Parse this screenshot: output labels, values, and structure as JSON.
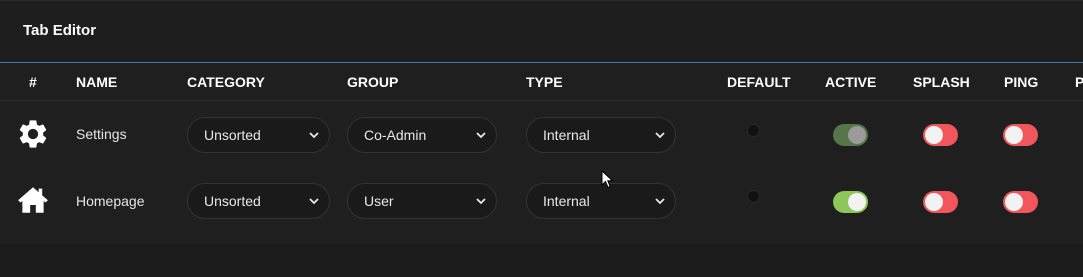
{
  "panel": {
    "title": "Tab Editor"
  },
  "columns": [
    "#",
    "NAME",
    "CATEGORY",
    "GROUP",
    "TYPE",
    "DEFAULT",
    "ACTIVE",
    "SPLASH",
    "PING",
    "P"
  ],
  "rows": [
    {
      "icon": "gear-icon",
      "name": "Settings",
      "category": "Unsorted",
      "group": "Co-Admin",
      "type": "Internal",
      "default": false,
      "active": {
        "on": true,
        "color": "#56754a",
        "disabled": true
      },
      "splash": {
        "on": false,
        "color": "#f0565c"
      },
      "ping": {
        "on": false,
        "color": "#f0565c"
      }
    },
    {
      "icon": "home-icon",
      "name": "Homepage",
      "category": "Unsorted",
      "group": "User",
      "type": "Internal",
      "default": false,
      "active": {
        "on": true,
        "color": "#8dc65a"
      },
      "splash": {
        "on": false,
        "color": "#f0565c"
      },
      "ping": {
        "on": false,
        "color": "#f0565c"
      }
    }
  ],
  "colors": {
    "accent_line": "#3f7fb1",
    "toggle_off": "#f0565c",
    "toggle_on": "#8dc65a",
    "toggle_on_disabled": "#56754a"
  }
}
